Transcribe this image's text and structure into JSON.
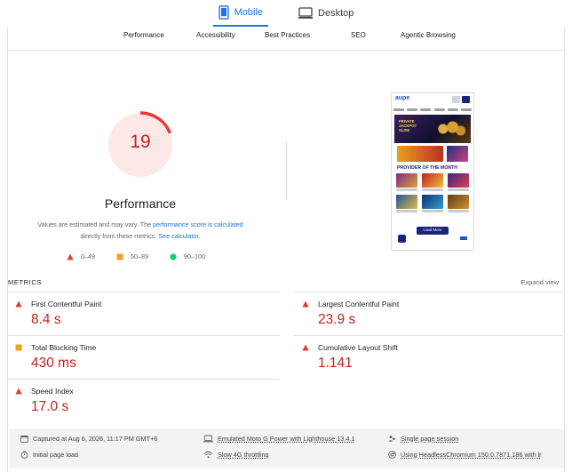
{
  "device_tabs": [
    {
      "label": "Mobile",
      "active": true
    },
    {
      "label": "Desktop",
      "active": false
    }
  ],
  "categories": [
    "Performance",
    "Accessibility",
    "Best Practices",
    "SEO",
    "Agentic Browsing"
  ],
  "performance": {
    "score": "19",
    "score_fraction": 0.19,
    "title": "Performance",
    "desc_part1": "Values are estimated and may vary. The ",
    "desc_link1": "performance score is calculated",
    "desc_part2": " directly from these metrics. ",
    "desc_link2": "See calculator."
  },
  "legend": [
    {
      "range": "0–49",
      "shape": "triangle",
      "color": "#e53935"
    },
    {
      "range": "50–89",
      "shape": "square",
      "color": "#f4a21d"
    },
    {
      "range": "90–100",
      "shape": "circle",
      "color": "#0cce6b"
    }
  ],
  "phone": {
    "logo": "aupe",
    "banner_text": "PRIVATE JACKPOT SLIDE",
    "provider_heading": "PROVIDER OF THE MONTH",
    "load_more": "Load More"
  },
  "metrics": {
    "heading": "METRICS",
    "expand": "Expand view",
    "items": [
      {
        "name": "First Contentful Paint",
        "value": "8.4 s",
        "rating": "poor"
      },
      {
        "name": "Largest Contentful Paint",
        "value": "23.9 s",
        "rating": "poor"
      },
      {
        "name": "Total Blocking Time",
        "value": "430 ms",
        "rating": "average"
      },
      {
        "name": "Cumulative Layout Shift",
        "value": "1.141",
        "rating": "poor"
      },
      {
        "name": "Speed Index",
        "value": "17.0 s",
        "rating": "poor"
      }
    ]
  },
  "footer_info": {
    "captured": "Captured at Aug 6, 2026, 11:17 PM GMT+6",
    "initial_load": "Initial page load",
    "device": "Emulated Moto G Power with Lighthouse 13.4.1",
    "throttling": "Slow 4G throttling",
    "session": "Single page session",
    "browser": "Using HeadlessChromium 150.0.7871.186 with lr"
  },
  "colors": {
    "accent": "#1a73e8",
    "poor": "#e53935",
    "poor_text": "#c5221f",
    "average": "#f4a21d",
    "good": "#0cce6b"
  }
}
